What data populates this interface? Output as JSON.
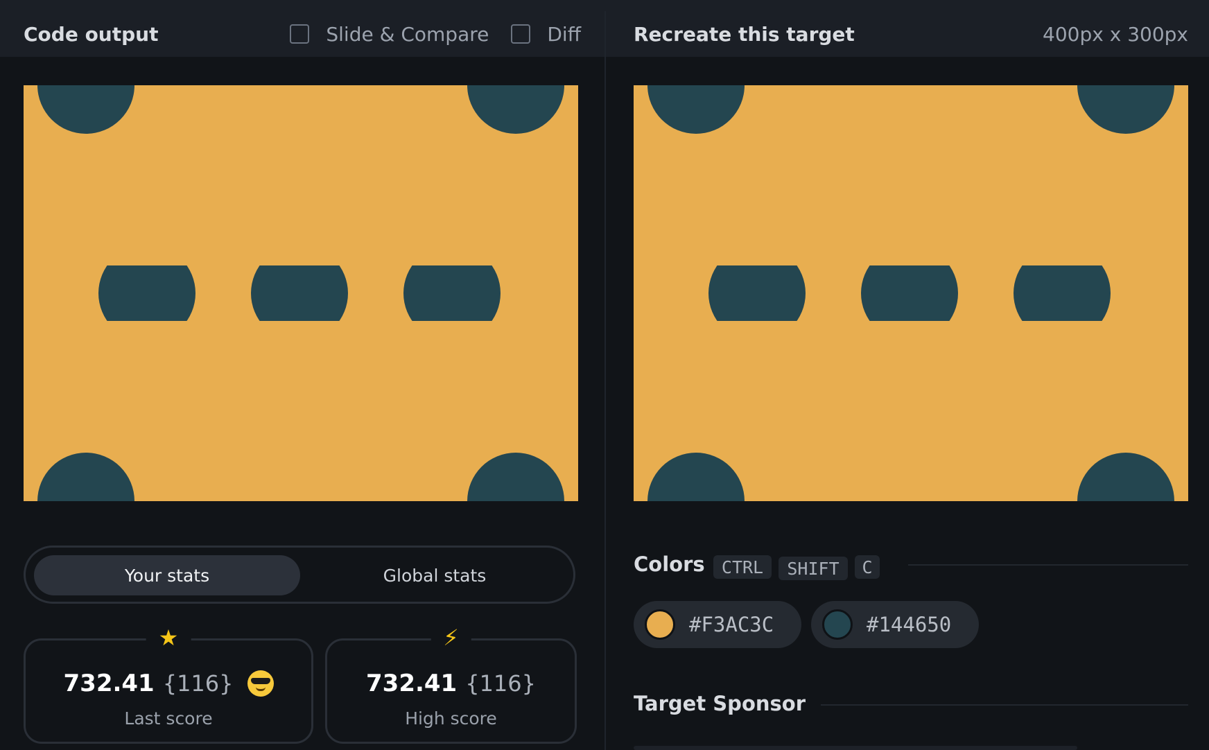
{
  "left_panel": {
    "title": "Code output",
    "slide_compare_label": "Slide & Compare",
    "diff_label": "Diff"
  },
  "right_panel": {
    "title": "Recreate this target",
    "dimensions": "400px x 300px"
  },
  "stats": {
    "tabs": [
      "Your stats",
      "Global stats"
    ],
    "last_score": {
      "icon": "star-icon",
      "value": "732.41",
      "sub": "{116}",
      "label": "Last score",
      "emoji": "sunglasses-face-icon"
    },
    "high_score": {
      "icon": "lightning-icon",
      "value": "732.41",
      "sub": "{116}",
      "label": "High score"
    }
  },
  "colors": {
    "title": "Colors",
    "shortcut": [
      "CTRL",
      "SHIFT",
      "C"
    ],
    "swatches": [
      {
        "hex": "#F3AC3C",
        "color": "#E8AE50"
      },
      {
        "hex": "#144650",
        "color": "#244650"
      }
    ]
  },
  "sponsor": {
    "title": "Target Sponsor"
  },
  "canvas_colors": {
    "background": "#E8AE50",
    "shape": "#244650"
  }
}
